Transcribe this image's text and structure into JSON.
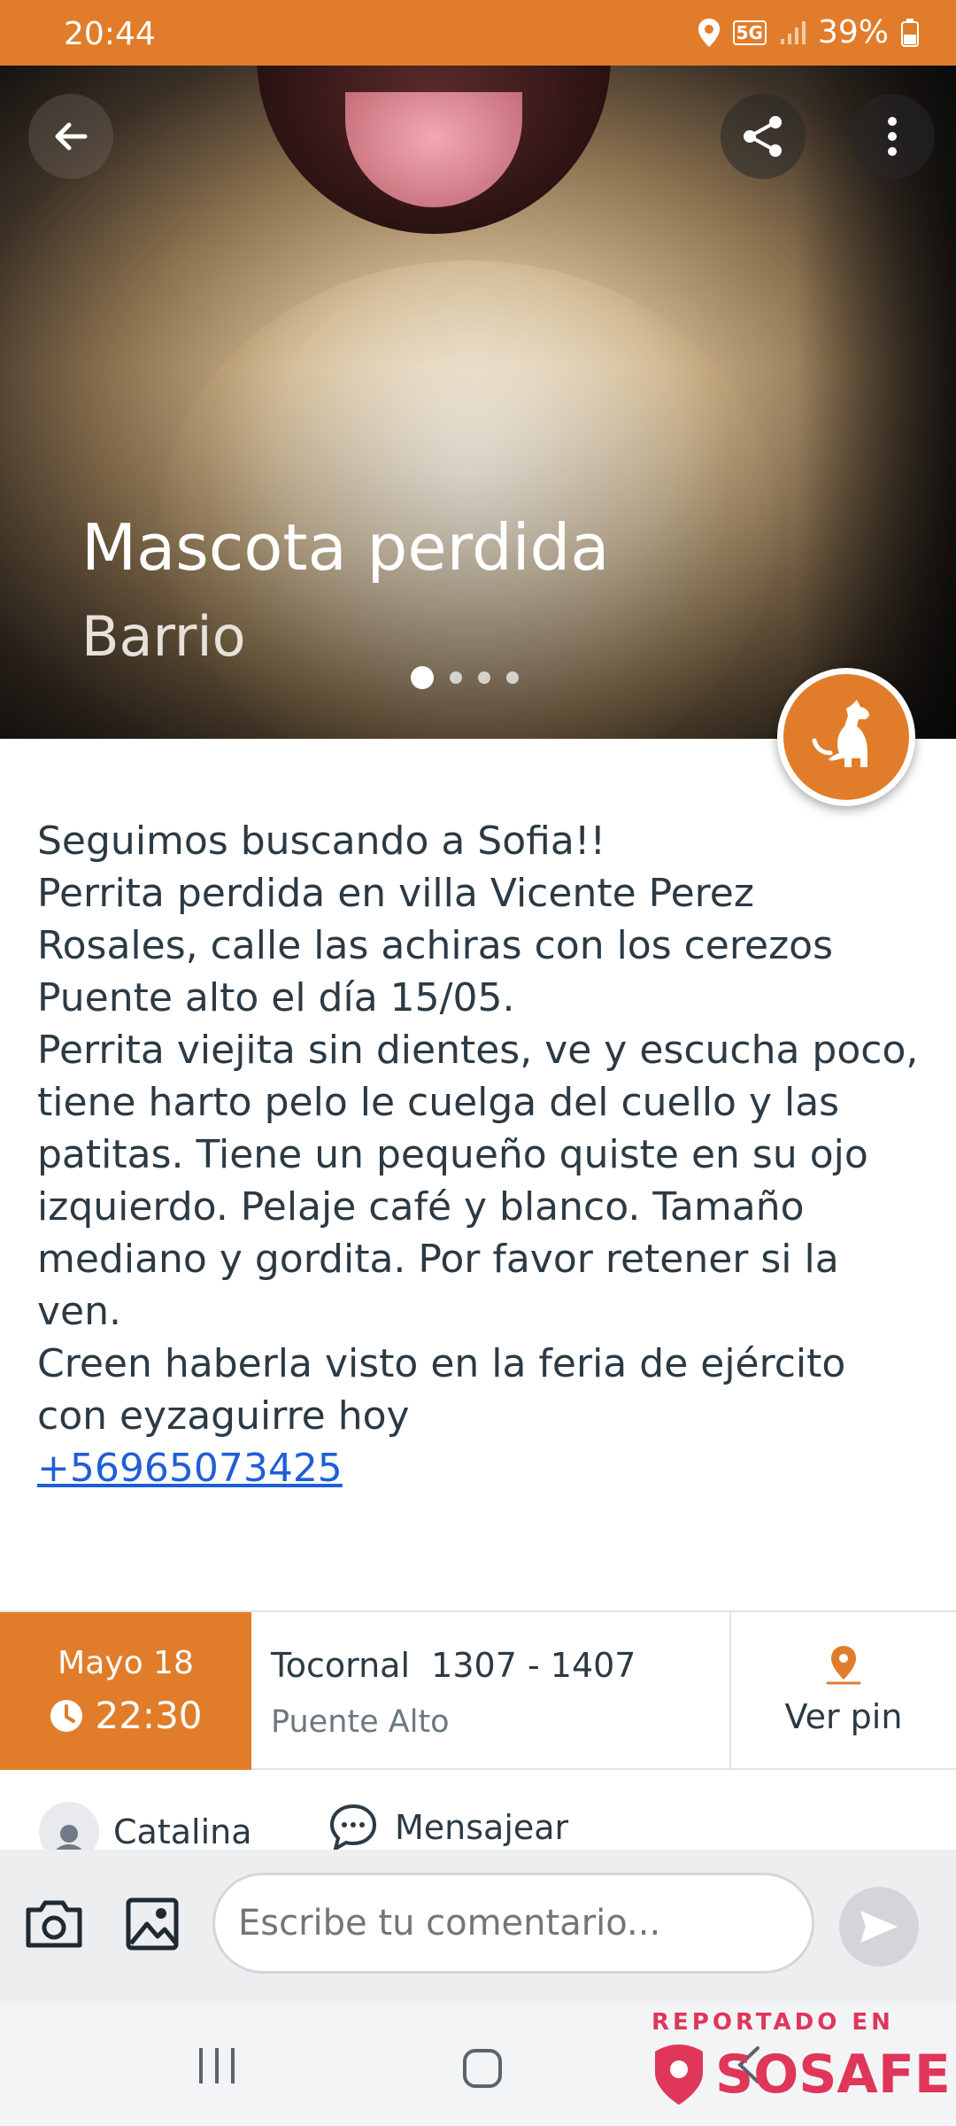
{
  "status_bar": {
    "time": "20:44",
    "network": "5G",
    "battery": "39%"
  },
  "hero": {
    "title": "Mascota perdida",
    "subtitle": "Barrio",
    "image_count": 4,
    "active_image": 1,
    "category_icon": "dog-icon"
  },
  "description": {
    "lines": [
      "Seguimos buscando a Sofia!!",
      "Perrita perdida en villa Vicente Perez Rosales, calle las achiras con los cerezos Puente alto el día 15/05.",
      "Perrita viejita sin dientes, ve y escucha poco, tiene harto pelo le cuelga del cuello y las patitas. Tiene un pequeño quiste en su ojo izquierdo. Pelaje café y blanco. Tamaño mediano y gordita. Por favor retener si la ven.",
      "Creen haberla visto en la feria de ejército con eyzaguirre hoy"
    ],
    "phone": "+56965073425"
  },
  "report_info": {
    "date": "Mayo 18",
    "time": "22:30",
    "street": "Tocornal  1307 - 1407",
    "commune": "Puente Alto",
    "pin_label": "Ver pin"
  },
  "author": {
    "name": "Catalina",
    "message_label": "Mensajear"
  },
  "comment_bar": {
    "placeholder": "Escribe tu comentario..."
  },
  "watermark": {
    "top_text": "REPORTADO EN",
    "brand": "SOSAFE"
  },
  "colors": {
    "accent": "#e17d2a",
    "link": "#1f5fd6",
    "brand": "#e0365a",
    "text": "#2b3a44"
  }
}
